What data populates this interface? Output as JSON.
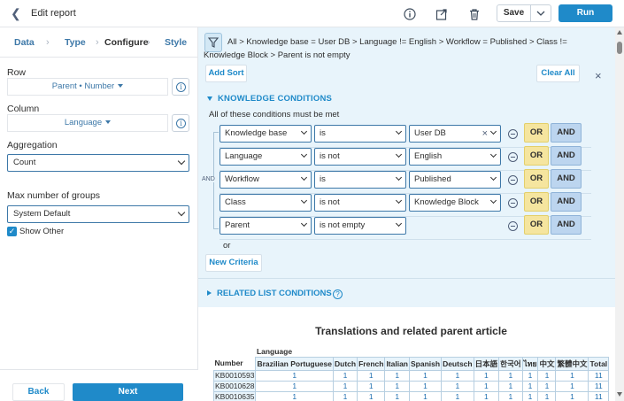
{
  "header": {
    "title": "Edit report",
    "save_label": "Save",
    "run_label": "Run"
  },
  "left": {
    "tabs": [
      {
        "label": "Data"
      },
      {
        "label": "Type"
      },
      {
        "label": "Configure"
      },
      {
        "label": "Style"
      }
    ],
    "row_label": "Row",
    "row_value": "Parent • Number",
    "column_label": "Column",
    "column_value": "Language",
    "aggregation_label": "Aggregation",
    "aggregation_value": "Count",
    "max_groups_label": "Max number of groups",
    "max_groups_value": "System Default",
    "show_other_label": "Show Other",
    "back_label": "Back",
    "next_label": "Next"
  },
  "filter": {
    "breadcrumb": "All  >  Knowledge base = User DB  >  Language != English  >  Workflow = Published  >  Class != Knowledge Block  >  Parent is not empty",
    "add_sort": "Add Sort",
    "clear_all": "Clear All",
    "kc_title": "KNOWLEDGE CONDITIONS",
    "kc_subtitle": "All of these conditions must be met",
    "and_label": "AND",
    "or_label": "or",
    "new_criteria": "New Criteria",
    "related_title": "RELATED LIST CONDITIONS",
    "conditions": [
      {
        "field": "Knowledge base",
        "operator": "is",
        "value": "User DB",
        "or": "OR",
        "and": "AND"
      },
      {
        "field": "Language",
        "operator": "is not",
        "value": "English",
        "or": "OR",
        "and": "AND"
      },
      {
        "field": "Workflow",
        "operator": "is",
        "value": "Published",
        "or": "OR",
        "and": "AND"
      },
      {
        "field": "Class",
        "operator": "is not",
        "value": "Knowledge Block",
        "or": "OR",
        "and": "AND"
      },
      {
        "field": "Parent",
        "operator": "is not empty",
        "value": "",
        "or": "OR",
        "and": "AND"
      }
    ]
  },
  "report": {
    "title": "Translations and related parent article",
    "group_header": "Language",
    "row_header": "Number",
    "columns": [
      "Brazilian Portuguese",
      "Dutch",
      "French",
      "Italian",
      "Spanish",
      "Deutsch",
      "日本語",
      "한국어",
      "ไทย",
      "中文",
      "繁體中文",
      "Total"
    ],
    "rows": [
      {
        "key": "KB0010593",
        "values": [
          "1",
          "1",
          "1",
          "1",
          "1",
          "1",
          "1",
          "1",
          "1",
          "1",
          "1",
          "11"
        ]
      },
      {
        "key": "KB0010628",
        "values": [
          "1",
          "1",
          "1",
          "1",
          "1",
          "1",
          "1",
          "1",
          "1",
          "1",
          "1",
          "11"
        ]
      },
      {
        "key": "KB0010635",
        "values": [
          "1",
          "1",
          "1",
          "1",
          "1",
          "1",
          "1",
          "1",
          "1",
          "1",
          "1",
          "11"
        ]
      }
    ]
  }
}
